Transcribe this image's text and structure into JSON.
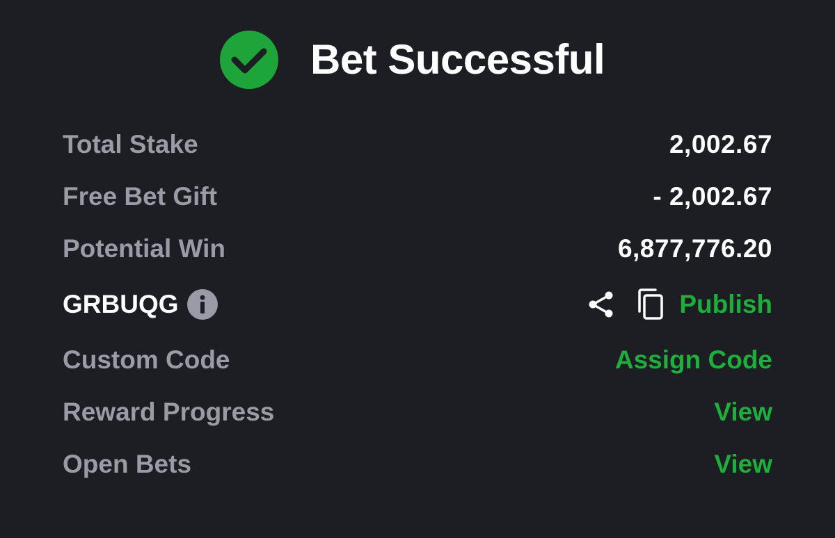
{
  "header": {
    "title": "Bet Successful",
    "icon": "check-circle-icon",
    "icon_color": "#1ea53a"
  },
  "summary": {
    "total_stake": {
      "label": "Total Stake",
      "value": "2,002.67"
    },
    "free_bet_gift": {
      "label": "Free Bet Gift",
      "value": "- 2,002.67"
    },
    "potential_win": {
      "label": "Potential Win",
      "value": "6,877,776.20"
    }
  },
  "booking": {
    "code": "GRBUQG",
    "info_icon": "info-icon",
    "share_icon": "share-icon",
    "copy_icon": "copy-icon",
    "publish_label": "Publish"
  },
  "custom_code": {
    "label": "Custom Code",
    "action": "Assign Code"
  },
  "reward_progress": {
    "label": "Reward Progress",
    "action": "View"
  },
  "open_bets": {
    "label": "Open Bets",
    "action": "View"
  },
  "colors": {
    "background": "#1d1e24",
    "accent_green": "#1fae3c",
    "label_gray": "#9a9ba6",
    "value_white": "#ffffff"
  }
}
